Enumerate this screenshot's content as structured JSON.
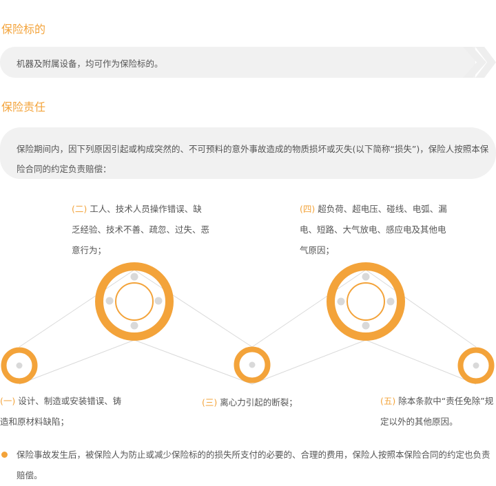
{
  "sections": {
    "subject": {
      "title": "保险标的",
      "text": "机器及附属设备，均可作为保险标的。"
    },
    "liability": {
      "title": "保险责任",
      "intro": "保险期间内，因下列原因引起或构成突然的、不可预料的意外事故造成的物质损坏或灭失(以下简称“损失”)，保险人按照本保险合同的约定负责赔偿：",
      "causes": [
        {
          "num": "(一)",
          "text": "设计、制造或安装错误、铸造和原材料缺陷；"
        },
        {
          "num": "(二)",
          "text": "工人、技术人员操作错误、缺乏经验、技术不善、疏忽、过失、恶意行为；"
        },
        {
          "num": "(三)",
          "text": "离心力引起的断裂；"
        },
        {
          "num": "(四)",
          "text": "超负荷、超电压、碰线、电弧、漏电、短路、大气放电、感应电及其他电气原因；"
        },
        {
          "num": "(五)",
          "text": "除本条款中“责任免除”规定以外的其他原因。"
        }
      ],
      "note": "保险事故发生后，被保险人为防止或减少保险标的的损失所支付的必要的、合理的费用，保险人按照本保险合同的约定也负责赔偿。"
    }
  },
  "colors": {
    "accent": "#f3a33a",
    "panel": "#f1f1f1",
    "chevron": "#eeeeee",
    "line": "#d9d9d9"
  }
}
